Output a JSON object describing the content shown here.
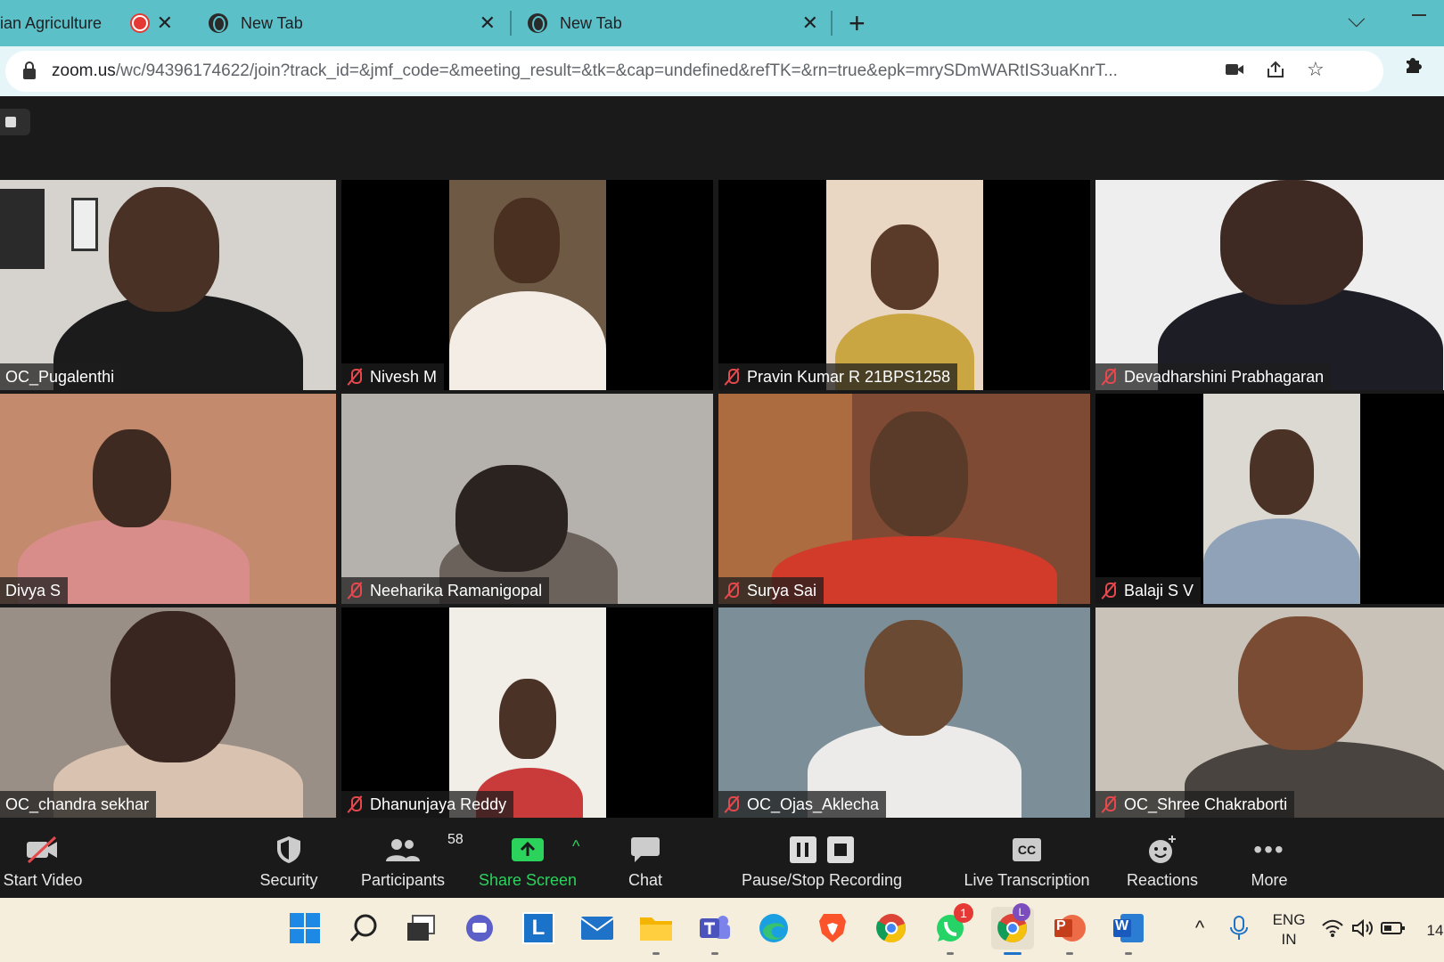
{
  "browser": {
    "tabs": [
      {
        "label": "ian Agriculture",
        "close": "✕"
      },
      {
        "label": "New Tab",
        "close": "✕"
      },
      {
        "label": "New Tab",
        "close": "✕"
      }
    ],
    "new_tab": "+",
    "url_host": "zoom.us",
    "url_path": "/wc/94396174622/join?track_id=&jmf_code=&meeting_result=&tk=&cap=undefined&refTK=&rn=true&epk=mrySDmWARtIS3uaKnrT..."
  },
  "participants": [
    {
      "name": "OC_Pugalenthi",
      "muted": false
    },
    {
      "name": "Nivesh M",
      "muted": true
    },
    {
      "name": "Pravin Kumar R 21BPS1258",
      "muted": true
    },
    {
      "name": "Devadharshini Prabhagaran",
      "muted": true
    },
    {
      "name": "Divya S",
      "muted": false
    },
    {
      "name": "Neeharika Ramanigopal",
      "muted": true
    },
    {
      "name": "Surya Sai",
      "muted": true
    },
    {
      "name": "Balaji S V",
      "muted": true
    },
    {
      "name": "OC_chandra sekhar",
      "muted": false
    },
    {
      "name": "Dhanunjaya Reddy",
      "muted": true
    },
    {
      "name": "OC_Ojas_Aklecha",
      "muted": true
    },
    {
      "name": "OC_Shree Chakraborti",
      "muted": true
    }
  ],
  "toolbar": {
    "start_video": "Start Video",
    "security": "Security",
    "participants": "Participants",
    "participants_count": "58",
    "share_screen": "Share Screen",
    "chat": "Chat",
    "recording": "Pause/Stop Recording",
    "live_transcription": "Live Transcription",
    "cc": "CC",
    "reactions": "Reactions",
    "more": "More"
  },
  "taskbar": {
    "whatsapp_badge": "1",
    "chrome_profile": "L",
    "launcher_letter": "L",
    "ppt_letter": "P",
    "word_letter": "W",
    "lang_top": "ENG",
    "lang_bottom": "IN",
    "clock_partial": "14"
  },
  "colors": {
    "tabbar": "#5cc0c8",
    "share_green": "#2bd35c",
    "mute_red": "#e5484d",
    "taskbar": "#f6eedd"
  }
}
